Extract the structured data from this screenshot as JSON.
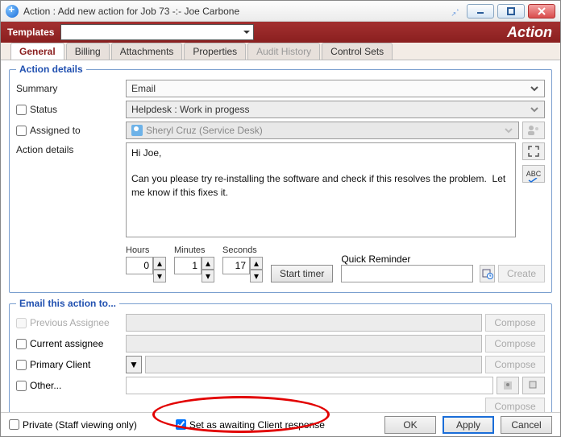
{
  "title": "Action : Add new action for Job 73 -:- Joe Carbone",
  "templates_label": "Templates",
  "brand": "Action",
  "tabs": [
    "General",
    "Billing",
    "Attachments",
    "Properties",
    "Audit History",
    "Control Sets"
  ],
  "legend_action": "Action details",
  "legend_email": "Email this action to...",
  "labels": {
    "summary": "Summary",
    "status": "Status",
    "assigned": "Assigned to",
    "details": "Action details",
    "hours": "Hours",
    "minutes": "Minutes",
    "seconds": "Seconds",
    "start_timer": "Start timer",
    "quick_reminder": "Quick Reminder",
    "create": "Create",
    "prev_assignee": "Previous Assignee",
    "curr_assignee": "Current assignee",
    "primary_client": "Primary Client",
    "other": "Other...",
    "compose": "Compose",
    "private": "Private (Staff viewing only)",
    "awaiting": "Set as awaiting Client response",
    "ok": "OK",
    "apply": "Apply",
    "cancel": "Cancel"
  },
  "values": {
    "summary": "Email",
    "status": "Helpdesk : Work in progess",
    "assigned": "Sheryl Cruz (Service Desk)",
    "details_text": "Hi Joe,\n\nCan you please try re-installing the software and check if this resolves the problem.  Let me know if this fixes it.",
    "hours": "0",
    "minutes": "1",
    "seconds": "17",
    "private_checked": false,
    "awaiting_checked": true
  }
}
